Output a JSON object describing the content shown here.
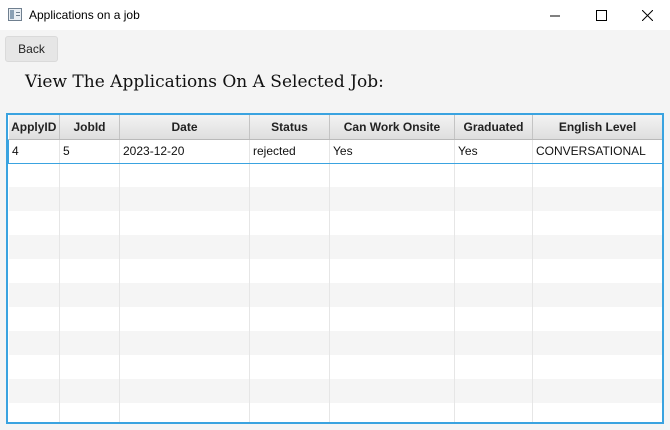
{
  "window": {
    "title": "Applications on a job"
  },
  "toolbar": {
    "back_label": "Back"
  },
  "page": {
    "heading": "View The Applications On A Selected Job:"
  },
  "table": {
    "columns": [
      "ApplyID",
      "JobId",
      "Date",
      "Status",
      "Can Work Onsite",
      "Graduated",
      "English Level"
    ],
    "rows": [
      [
        "4",
        "5",
        "2023-12-20",
        "rejected",
        "Yes",
        "Yes",
        "CONVERSATIONAL"
      ]
    ]
  },
  "colors": {
    "selection_border": "#3aa3e0",
    "header_bg": "#e3e3e3",
    "stripe": "#f5f5f5"
  }
}
